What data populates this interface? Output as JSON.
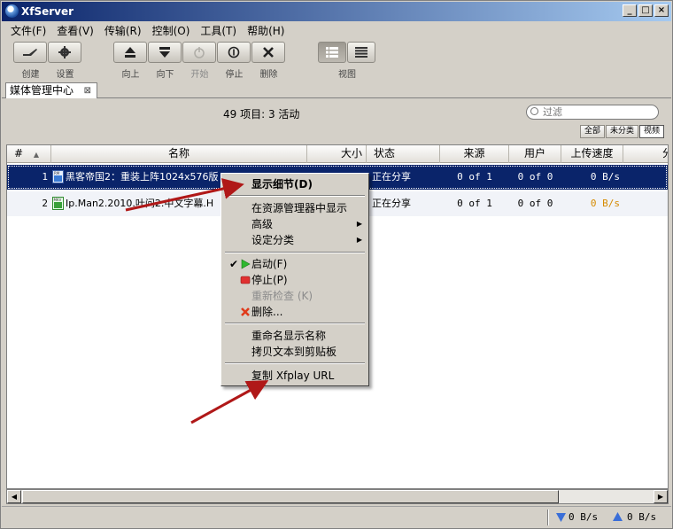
{
  "window": {
    "title": "XfServer"
  },
  "menubar": [
    "文件(F)",
    "查看(V)",
    "传输(R)",
    "控制(O)",
    "工具(T)",
    "帮助(H)"
  ],
  "toolbar": {
    "labels": [
      "创建",
      "设置",
      "向上",
      "向下",
      "开始",
      "停止",
      "删除",
      "视图"
    ]
  },
  "tab": {
    "label": "媒体管理中心"
  },
  "summary": {
    "text": "49 项目: 3 活动"
  },
  "filter": {
    "placeholder": "过滤"
  },
  "view_modes": [
    "全部",
    "未分类",
    "视频"
  ],
  "columns": [
    "#",
    "名称",
    "大小",
    "状态",
    "来源",
    "用户",
    "上传速度",
    "分"
  ],
  "rows": [
    {
      "num": "1",
      "name": "黑客帝国2：重装上阵1024x576版",
      "status": "正在分享",
      "source": "0 of 1",
      "users": "0 of 0",
      "speed": "0 B/s"
    },
    {
      "num": "2",
      "name": "Ip.Man2.2010.叶问2.中文字幕.H",
      "status": "正在分享",
      "source": "0 of 1",
      "users": "0 of 0",
      "speed": "0 B/s"
    }
  ],
  "context_menu": {
    "details": "显示细节(D)",
    "show_in_explorer": "在资源管理器中显示",
    "advanced": "高级",
    "set_category": "设定分类",
    "start": "启动(F)",
    "stop": "停止(P)",
    "recheck": "重新检查 (K)",
    "delete": "删除...",
    "rename": "重命名显示名称",
    "copy_text": "拷贝文本到剪贴板",
    "copy_url": "复制 Xfplay URL"
  },
  "status": {
    "down": "0 B/s",
    "up": "0 B/s"
  },
  "colors": {
    "selection": "#0a246a",
    "arrow": "#b01818",
    "titlebar": "#0a246a"
  }
}
